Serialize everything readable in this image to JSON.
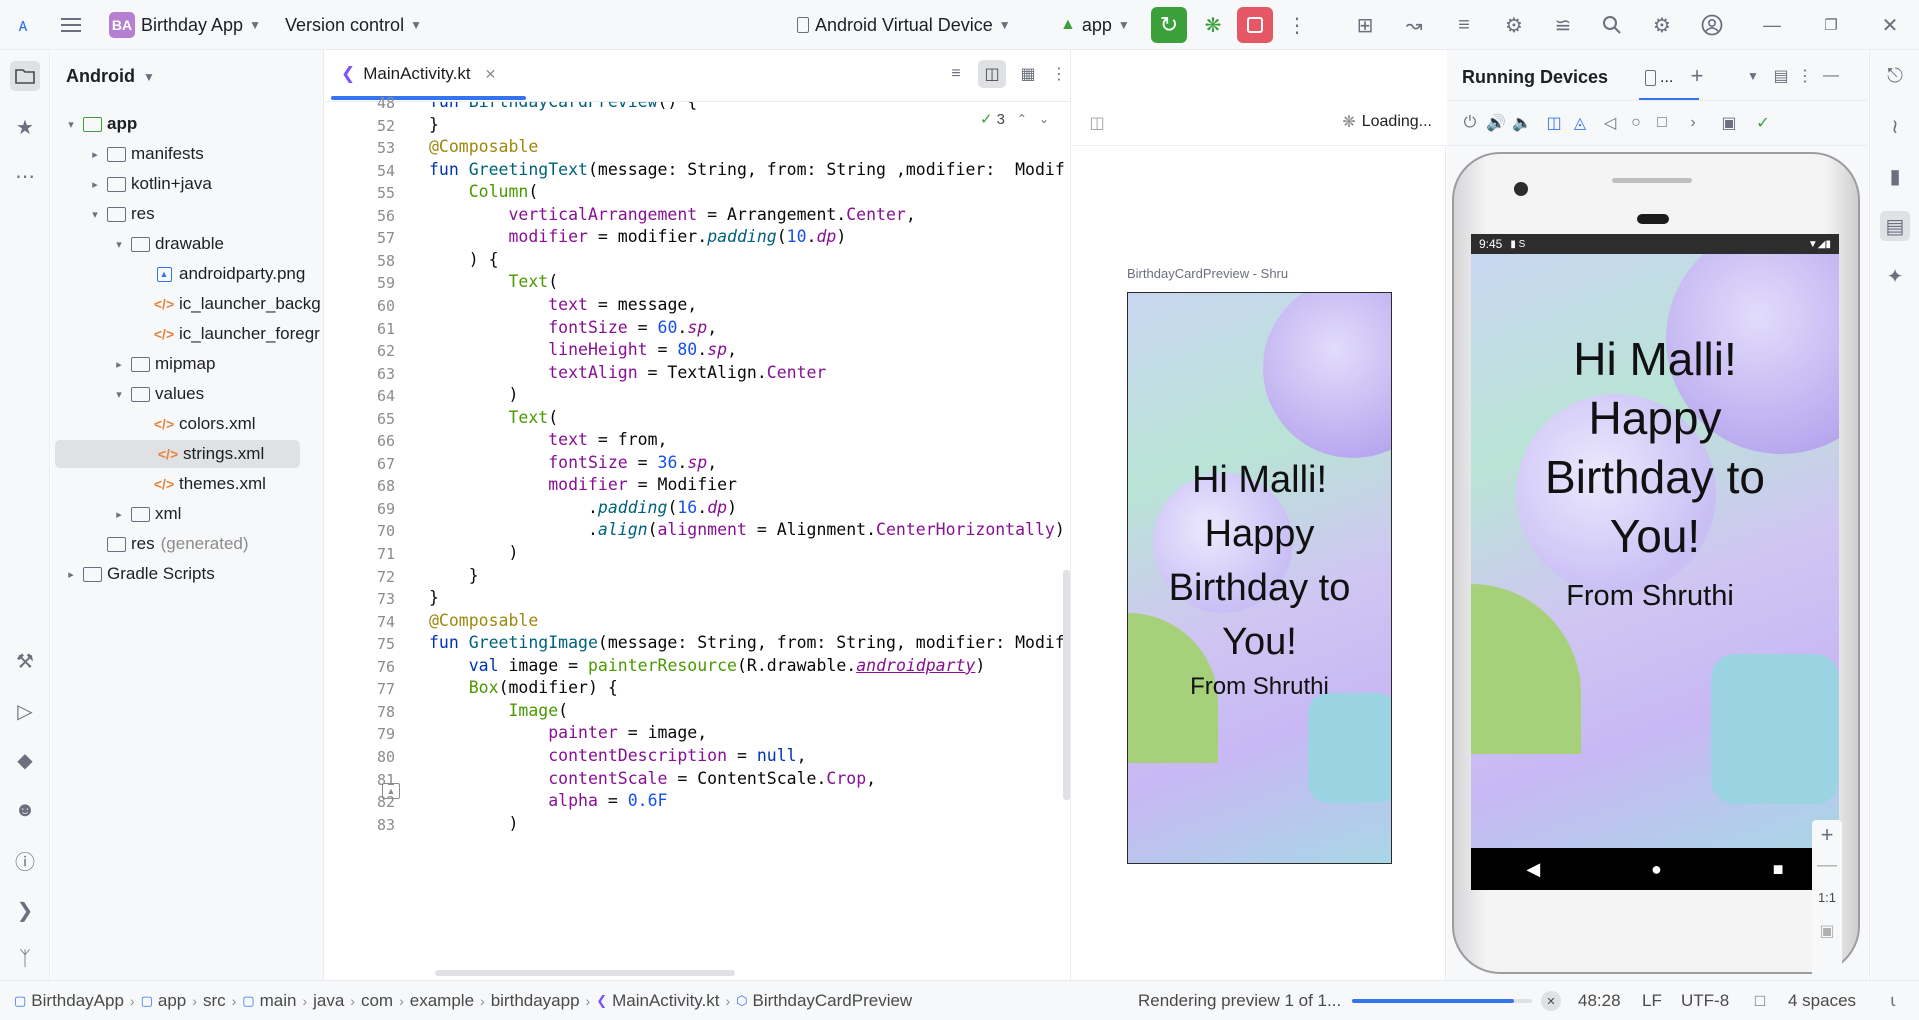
{
  "title_bar": {
    "project_badge": "BA",
    "project_name": "Birthday App",
    "vcs": "Version control",
    "device": "Android Virtual Device",
    "run_config": "app"
  },
  "project_panel": {
    "view": "Android",
    "tree": [
      {
        "label": "app",
        "depth": 0,
        "expanded": true,
        "icon": "module-folder-icon",
        "bold": true
      },
      {
        "label": "manifests",
        "depth": 1,
        "expanded": false,
        "icon": "folder-icon"
      },
      {
        "label": "kotlin+java",
        "depth": 1,
        "expanded": false,
        "icon": "folder-icon"
      },
      {
        "label": "res",
        "depth": 1,
        "expanded": true,
        "icon": "res-folder-icon"
      },
      {
        "label": "drawable",
        "depth": 2,
        "expanded": true,
        "icon": "res-folder-icon"
      },
      {
        "label": "androidparty.png",
        "depth": 3,
        "icon": "image-file-icon"
      },
      {
        "label": "ic_launcher_backg",
        "depth": 3,
        "icon": "xml-file-icon"
      },
      {
        "label": "ic_launcher_foregr",
        "depth": 3,
        "icon": "xml-file-icon"
      },
      {
        "label": "mipmap",
        "depth": 2,
        "expanded": false,
        "icon": "res-folder-icon"
      },
      {
        "label": "values",
        "depth": 2,
        "expanded": true,
        "icon": "res-folder-icon"
      },
      {
        "label": "colors.xml",
        "depth": 3,
        "icon": "xml-file-icon"
      },
      {
        "label": "strings.xml",
        "depth": 3,
        "icon": "xml-file-icon",
        "selected": true
      },
      {
        "label": "themes.xml",
        "depth": 3,
        "icon": "xml-file-icon"
      },
      {
        "label": "xml",
        "depth": 2,
        "expanded": false,
        "icon": "res-folder-icon"
      },
      {
        "label": "res",
        "suffix": "(generated)",
        "depth": 1,
        "icon": "res-folder-icon"
      },
      {
        "label": "Gradle Scripts",
        "depth": 0,
        "expanded": false,
        "icon": "gradle-icon"
      }
    ]
  },
  "editor": {
    "tab": "MainActivity.kt",
    "inspection_count": "3",
    "line_numbers": [
      "48",
      "52",
      "53",
      "54",
      "55",
      "56",
      "57",
      "58",
      "59",
      "60",
      "61",
      "62",
      "63",
      "64",
      "65",
      "66",
      "67",
      "68",
      "69",
      "70",
      "71",
      "72",
      "73",
      "74",
      "75",
      "76",
      "77",
      "78",
      "79",
      "80",
      "81",
      "82",
      "83"
    ],
    "code_lines": [
      "fun BirthdayCardPreview() {",
      "}",
      "@Composable",
      "fun GreetingText(message: String, from: String ,modifier:  Modif",
      "    Column(",
      "        verticalArrangement = Arrangement.Center,",
      "        modifier = modifier.padding(10.dp)",
      "    ) {",
      "        Text(",
      "            text = message,",
      "            fontSize = 60.sp,",
      "            lineHeight = 80.sp,",
      "            textAlign = TextAlign.Center",
      "        )",
      "        Text(",
      "            text = from,",
      "            fontSize = 36.sp,",
      "            modifier = Modifier",
      "                .padding(16.dp)",
      "                .align(alignment = Alignment.CenterHorizontally)",
      "        )",
      "    }",
      "}",
      "@Composable",
      "fun GreetingImage(message: String, from: String, modifier: Modif",
      "    val image = painterResource(R.drawable.androidparty)",
      "    Box(modifier) {",
      "        Image(",
      "            painter = image,",
      "            contentDescription = null,",
      "            contentScale = ContentScale.Crop,",
      "            alpha = 0.6F",
      "        )"
    ]
  },
  "preview": {
    "status": "Loading...",
    "card_label": "BirthdayCardPreview - Shru",
    "greeting": [
      "Hi Malli!",
      "Happy",
      "Birthday to",
      "You!"
    ],
    "from": "From Shruthi"
  },
  "running_devices": {
    "title": "Running Devices",
    "tab_label": "...",
    "phone_time": "9:45",
    "greeting": [
      "Hi Malli!",
      "Happy",
      "Birthday to",
      "You!"
    ],
    "from": "From Shruthi",
    "zoom_fit": "1:1"
  },
  "status_bar": {
    "breadcrumbs": [
      "BirthdayApp",
      "app",
      "src",
      "main",
      "java",
      "com",
      "example",
      "birthdayapp",
      "MainActivity.kt",
      "BirthdayCardPreview"
    ],
    "task": "Rendering preview 1 of 1...",
    "task_progress": 0.9,
    "position": "48:28",
    "line_sep": "LF",
    "encoding": "UTF-8",
    "indent": "4 spaces"
  },
  "colors": {
    "accent": "#3574f0",
    "run_green": "#3ca03a",
    "stop_red": "#e55765",
    "badge": "#b580d1"
  }
}
